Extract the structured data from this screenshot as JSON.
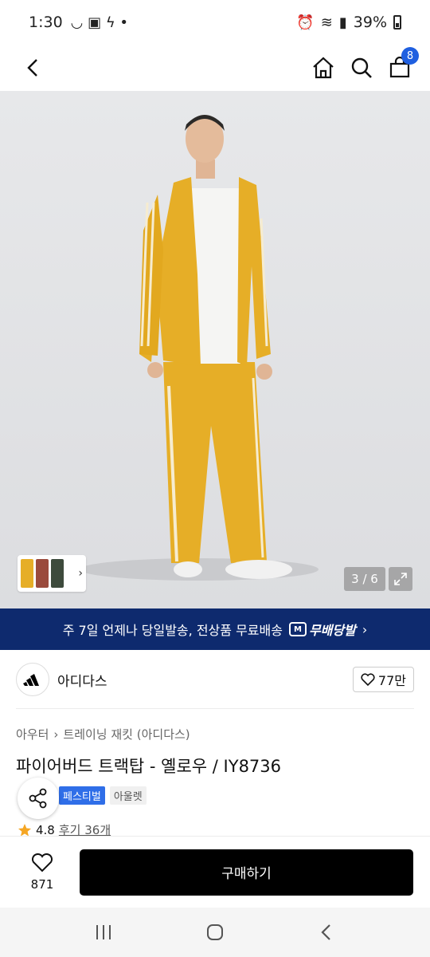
{
  "status_bar": {
    "time": "1:30",
    "battery": "39%"
  },
  "nav": {
    "cart_count": "8"
  },
  "gallery": {
    "counter": "3 / 6"
  },
  "promo": {
    "text": "주 7일 언제나 당일발송, 전상품 무료배송",
    "badge": "무배당발",
    "arrow": "›"
  },
  "brand": {
    "name": "아디다스",
    "likes": "77만"
  },
  "product": {
    "breadcrumb": [
      "아우터",
      "트레이닝 재킷 (아디다스)"
    ],
    "title": "파이어버드 트랙탑 - 옐로우 / IY8736",
    "tags": [
      "페스티벌",
      "아울렛"
    ],
    "rating": "4.8",
    "review_label": "후기 36개"
  },
  "buy_bar": {
    "wish_count": "871",
    "buy_label": "구매하기"
  },
  "colors": {
    "banner": "#0e2a6e",
    "jacket": "#e6ae27",
    "badge": "#1f5fe0"
  }
}
